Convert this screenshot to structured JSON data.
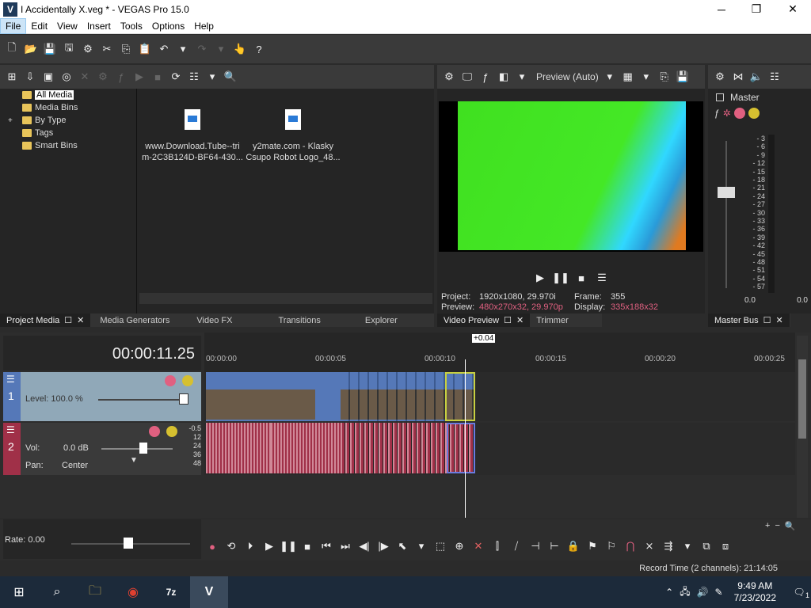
{
  "window": {
    "title": "I Accidentally X.veg * - VEGAS Pro 15.0",
    "logo_letter": "V",
    "minimize_glyph": "─",
    "maximize_glyph": "❐",
    "close_glyph": "✕"
  },
  "menu": [
    "File",
    "Edit",
    "View",
    "Insert",
    "Tools",
    "Options",
    "Help"
  ],
  "project_media": {
    "tree": [
      {
        "label": "All Media",
        "selected": true
      },
      {
        "label": "Media Bins"
      },
      {
        "label": "By Type",
        "expander": "+"
      },
      {
        "label": "Tags"
      },
      {
        "label": "Smart Bins"
      }
    ],
    "files": [
      {
        "line1": "www.Download.Tube--tri",
        "line2": "m-2C3B124D-BF64-430..."
      },
      {
        "line1": "y2mate.com - Klasky",
        "line2": "Csupo Robot Logo_48..."
      }
    ]
  },
  "bottom_tabs_left": [
    {
      "label": "Project Media",
      "active": true
    },
    {
      "label": "Media Generators"
    },
    {
      "label": "Video FX"
    },
    {
      "label": "Transitions"
    },
    {
      "label": "Explorer"
    }
  ],
  "preview": {
    "mode_label": "Preview (Auto)",
    "project_label": "Project:",
    "project_value": "1920x1080, 29.970i",
    "frame_label": "Frame:",
    "frame_value": "355",
    "preview_label": "Preview:",
    "preview_value": "480x270x32, 29.970p",
    "display_label": "Display:",
    "display_value": "335x188x32",
    "tabs": [
      {
        "label": "Video Preview",
        "active": true
      },
      {
        "label": "Trimmer"
      }
    ]
  },
  "master_bus": {
    "label": "Master",
    "scale": [
      "3",
      "6",
      "9",
      "12",
      "15",
      "18",
      "21",
      "24",
      "27",
      "30",
      "33",
      "36",
      "39",
      "42",
      "45",
      "48",
      "51",
      "54",
      "57"
    ],
    "left_value": "0.0",
    "right_value": "0.0",
    "tab_label": "Master Bus"
  },
  "timeline": {
    "timecode": "00:00:11.25",
    "cursor_badge": "+0.04",
    "ruler": [
      "00:00:00",
      "00:00:05",
      "00:00:10",
      "00:00:15",
      "00:00:20",
      "00:00:25"
    ],
    "video_track": {
      "number": "1",
      "level_label": "Level: 100.0 %"
    },
    "audio_track": {
      "number": "2",
      "vol_label": "Vol:",
      "vol_value": "0.0 dB",
      "pan_label": "Pan:",
      "pan_value": "Center",
      "scale": [
        "-0.5",
        "12",
        "24",
        "36",
        "48"
      ]
    },
    "rate_label": "Rate: 0.00"
  },
  "status": {
    "record_time": "Record Time (2 channels): 21:14:05"
  },
  "taskbar": {
    "time": "9:49 AM",
    "date": "7/23/2022",
    "notifications": "1"
  },
  "colors": {
    "video_track": "#5578b8",
    "audio_track": "#a03048",
    "preview_green": "#40e020"
  }
}
